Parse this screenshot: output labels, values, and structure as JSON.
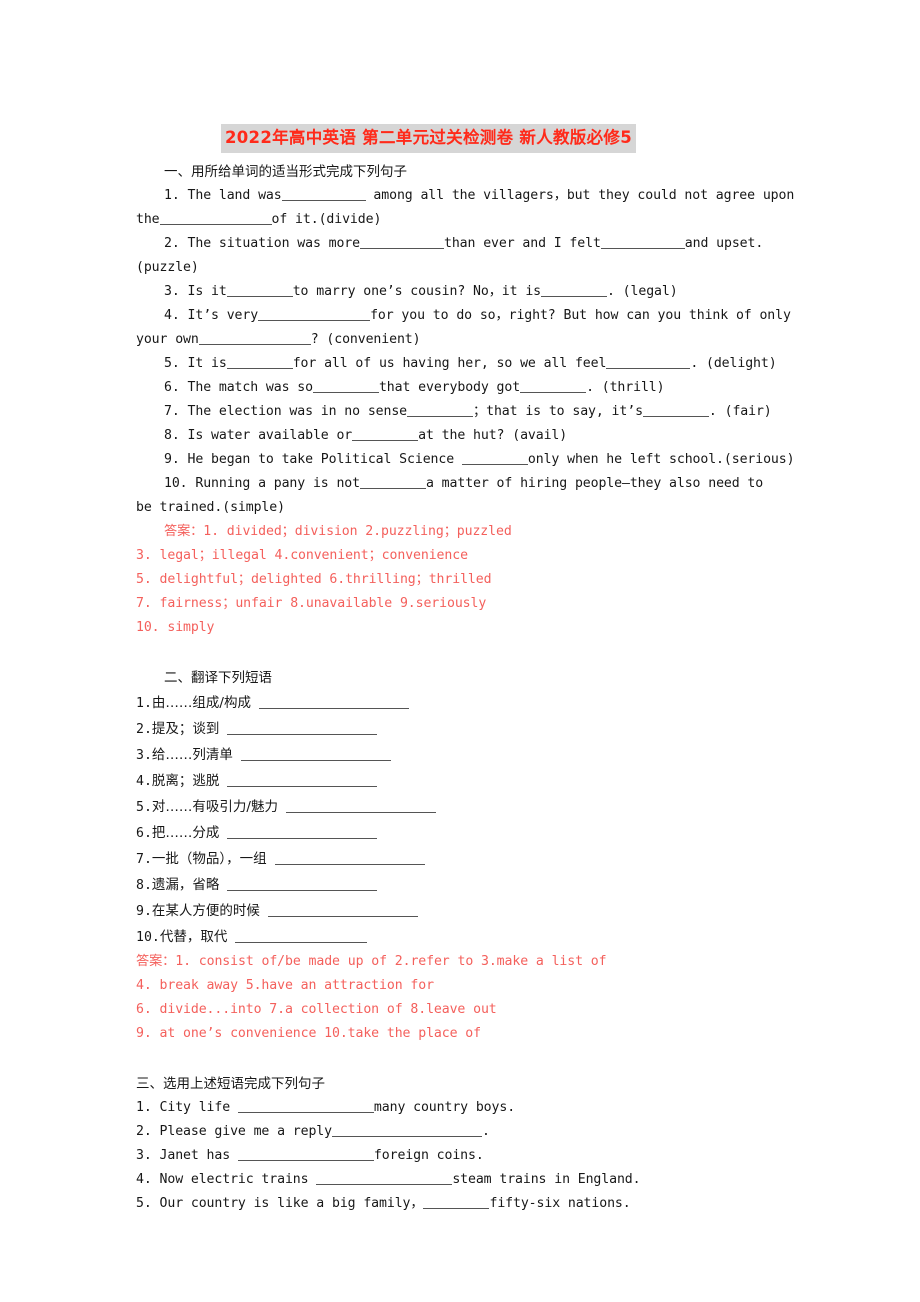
{
  "document": {
    "title": "2022年高中英语 第二单元过关检测卷 新人教版必修5",
    "title_bg_color": "#d6d6d6",
    "title_text_color": "#ff2a1a",
    "answer_text_color": "#f4605c",
    "body_text_color": "#171717"
  },
  "section1": {
    "heading": "一、用所给单词的适当形式完成下列句子",
    "questions": [
      {
        "part_a": "1. The land was",
        "part_b": " among all the villagers，but they could not agree upon",
        "part_c": "the",
        "part_d": "of it.(divide)"
      },
      {
        "part_a": "2. The situation was more",
        "part_b": "than ever and I felt",
        "part_c": "and upset.(puzzle)"
      },
      {
        "part_a": "3. Is it",
        "part_b": "to marry one’s cousin? No，it is",
        "part_c": ". (legal)"
      },
      {
        "part_a": "4. It’s very",
        "part_b": "for you to do so，right? But how can you think of only",
        "part_c": "your own",
        "part_d": "?  (convenient)"
      },
      {
        "part_a": "5. It is",
        "part_b": "for all of us having her, so we all feel",
        "part_c": ". (delight)"
      },
      {
        "part_a": "6. The match was so",
        "part_b": "that everybody got",
        "part_c": ". (thrill)"
      },
      {
        "part_a": "7. The election was in no sense",
        "part_b": "；that is to say, it’s",
        "part_c": ". (fair)"
      },
      {
        "part_a": "8. Is water available or",
        "part_b": "at the hut? (avail)"
      },
      {
        "part_a": "9. He began to take Political Science ",
        "part_b": "only when he left school.(serious)"
      },
      {
        "part_a": "10. Running a pany is not",
        "part_b": "a matter of hiring people—they also need to",
        "part_c": "be trained.(simple)"
      }
    ],
    "answers": {
      "label": "答案：",
      "lines": [
        "1. divided；division  2.puzzling；puzzled",
        "3. legal；illegal  4.convenient；convenience",
        "5. delightful；delighted  6.thrilling；thrilled",
        "7. fairness；unfair  8.unavailable  9.seriously",
        "10. simply"
      ]
    }
  },
  "section2": {
    "heading": "二、翻译下列短语",
    "items": [
      {
        "num": "1.",
        "text": "由……组成/构成",
        "blank_width": "wide"
      },
      {
        "num": "2.",
        "text": "提及；谈到",
        "blank_width": "wide"
      },
      {
        "num": "3.",
        "text": "给……列清单",
        "blank_width": "wide"
      },
      {
        "num": "4.",
        "text": "脱离；逃脱",
        "blank_width": "wide"
      },
      {
        "num": "5.",
        "text": "对……有吸引力/魅力",
        "blank_width": "wide"
      },
      {
        "num": "6.",
        "text": "把……分成",
        "blank_width": "wide"
      },
      {
        "num": "7.",
        "text": "一批（物品），一组",
        "blank_width": "wide"
      },
      {
        "num": "8.",
        "text": "遗漏，省略",
        "blank_width": "wide"
      },
      {
        "num": "9.",
        "text": "在某人方便的时候",
        "blank_width": "wide"
      },
      {
        "num": "10.",
        "text": "代替，取代",
        "blank_width": "wide"
      }
    ],
    "answers": {
      "label": "答案：",
      "lines": [
        "1. consist of/be made up of  2.refer to  3.make a list of",
        "4. break away  5.have an attraction for",
        "6. divide...into  7.a collection of  8.leave out",
        "9. at one’s convenience  10.take the place of"
      ]
    }
  },
  "section3": {
    "heading": "三、选用上述短语完成下列句子",
    "questions": [
      {
        "part_a": "1. City life ",
        "part_b": "many country boys."
      },
      {
        "part_a": "2. Please give me a reply",
        "part_b": "."
      },
      {
        "part_a": "3. Janet has ",
        "part_b": "foreign coins."
      },
      {
        "part_a": "4. Now electric trains ",
        "part_b": "steam trains in England."
      },
      {
        "part_a": "5. Our country is like a big family，",
        "part_b": "fifty-six nations."
      }
    ]
  }
}
